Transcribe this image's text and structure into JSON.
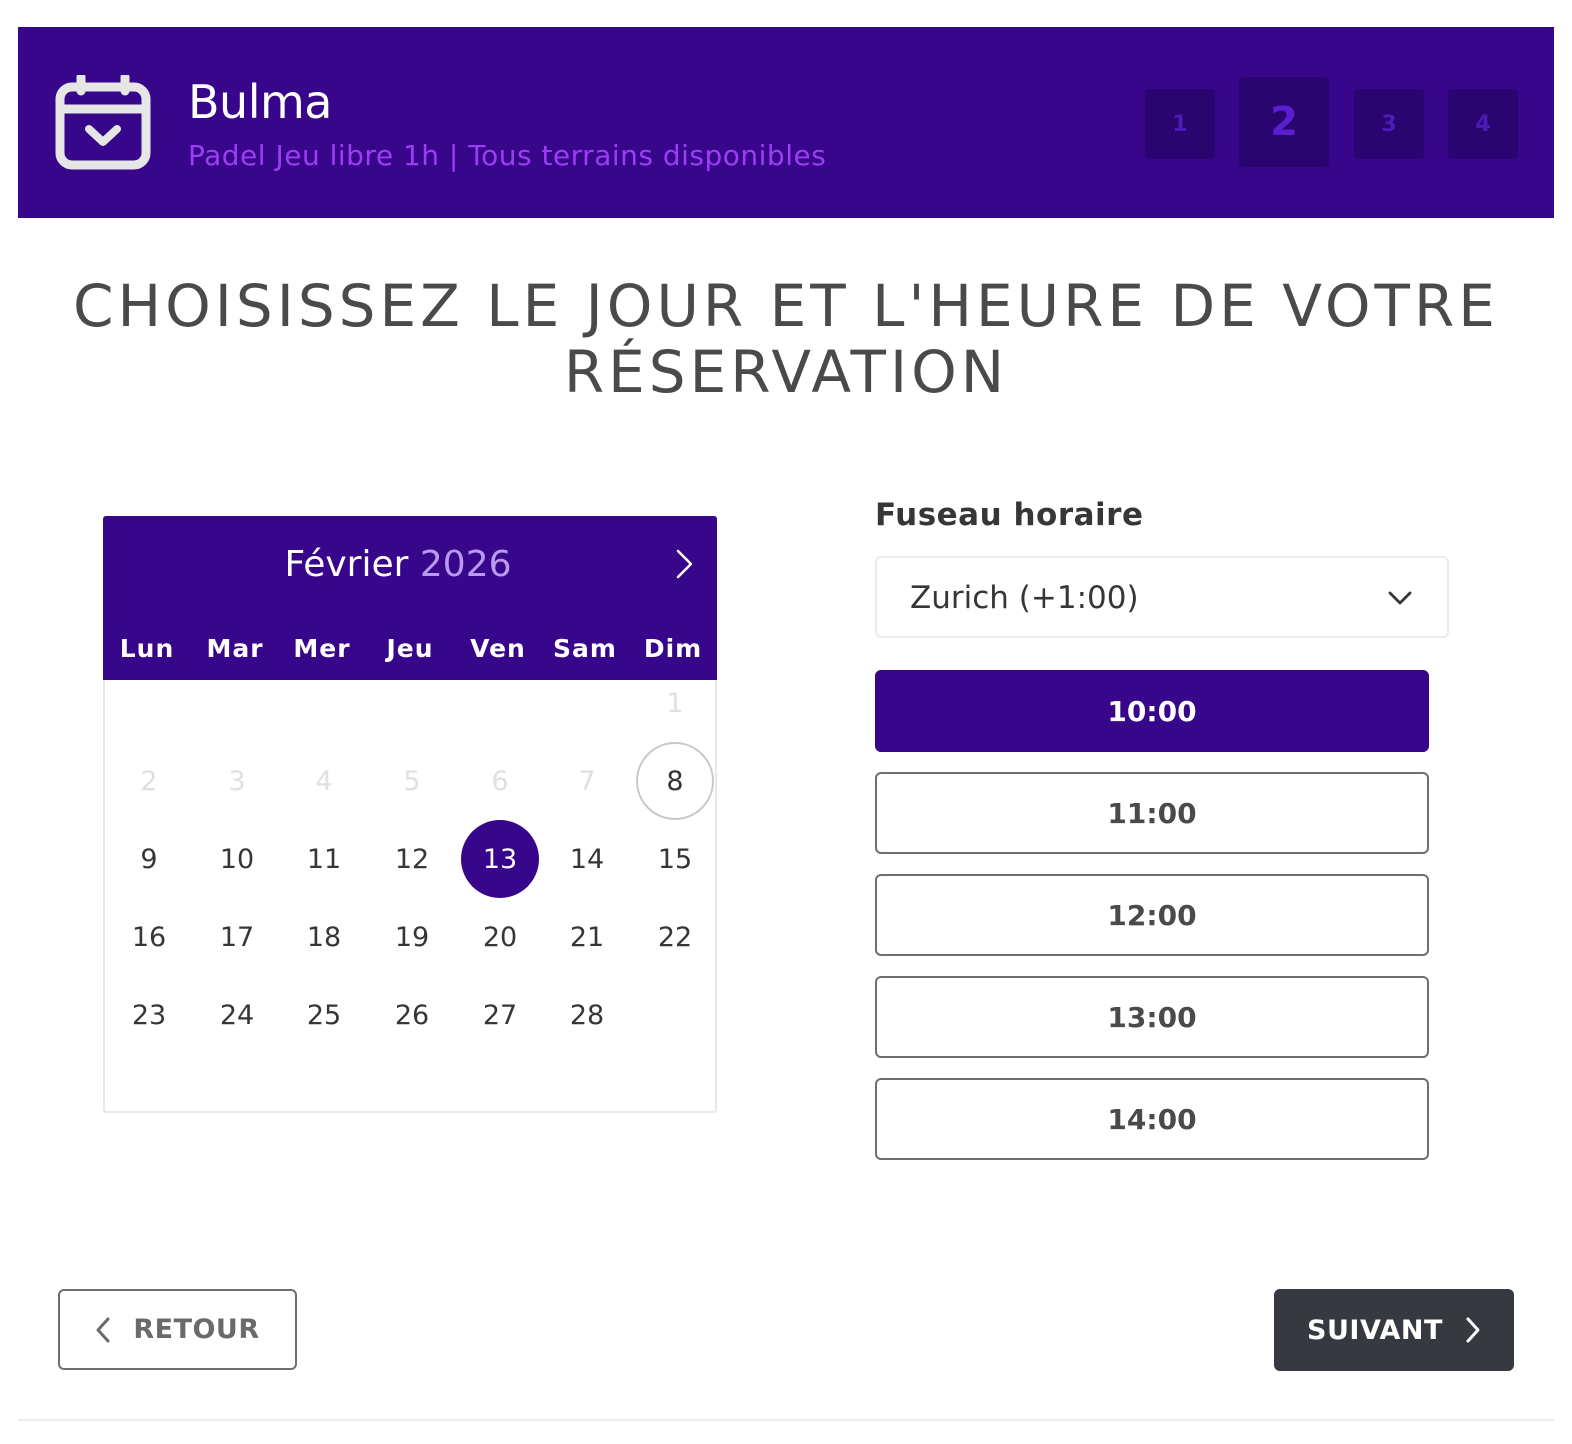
{
  "header": {
    "brand": "Bulma",
    "subtitle": "Padel Jeu libre 1h | Tous terrains disponibles",
    "icon": "calendar-check-icon",
    "steps": [
      {
        "label": "1",
        "active": false
      },
      {
        "label": "2",
        "active": true
      },
      {
        "label": "3",
        "active": false
      },
      {
        "label": "4",
        "active": false
      }
    ]
  },
  "page": {
    "title_line1": "CHOISISSEZ LE JOUR ET L'HEURE DE VOTRE",
    "title_line2": "RÉSERVATION"
  },
  "calendar": {
    "month": "Février",
    "year": "2026",
    "next_icon": "chevron-right-icon",
    "weekdays": [
      "Lun",
      "Mar",
      "Mer",
      "Jeu",
      "Ven",
      "Sam",
      "Dim"
    ],
    "days": [
      "1",
      "2",
      "3",
      "4",
      "5",
      "6",
      "7",
      "8",
      "9",
      "10",
      "11",
      "12",
      "13",
      "14",
      "15",
      "16",
      "17",
      "18",
      "19",
      "20",
      "21",
      "22",
      "23",
      "24",
      "25",
      "26",
      "27",
      "28"
    ],
    "today": "8",
    "selected": "13"
  },
  "timezone": {
    "label": "Fuseau horaire",
    "value": "Zurich (+1:00)"
  },
  "slots": [
    {
      "label": "10:00",
      "active": true
    },
    {
      "label": "11:00",
      "active": false
    },
    {
      "label": "12:00",
      "active": false
    },
    {
      "label": "13:00",
      "active": false
    },
    {
      "label": "14:00",
      "active": false
    }
  ],
  "nav": {
    "back_label": "RETOUR",
    "next_label": "SUIVANT"
  },
  "colors": {
    "primary": "#38068a",
    "accent": "#9b3df5",
    "dark_button": "#363a40"
  }
}
